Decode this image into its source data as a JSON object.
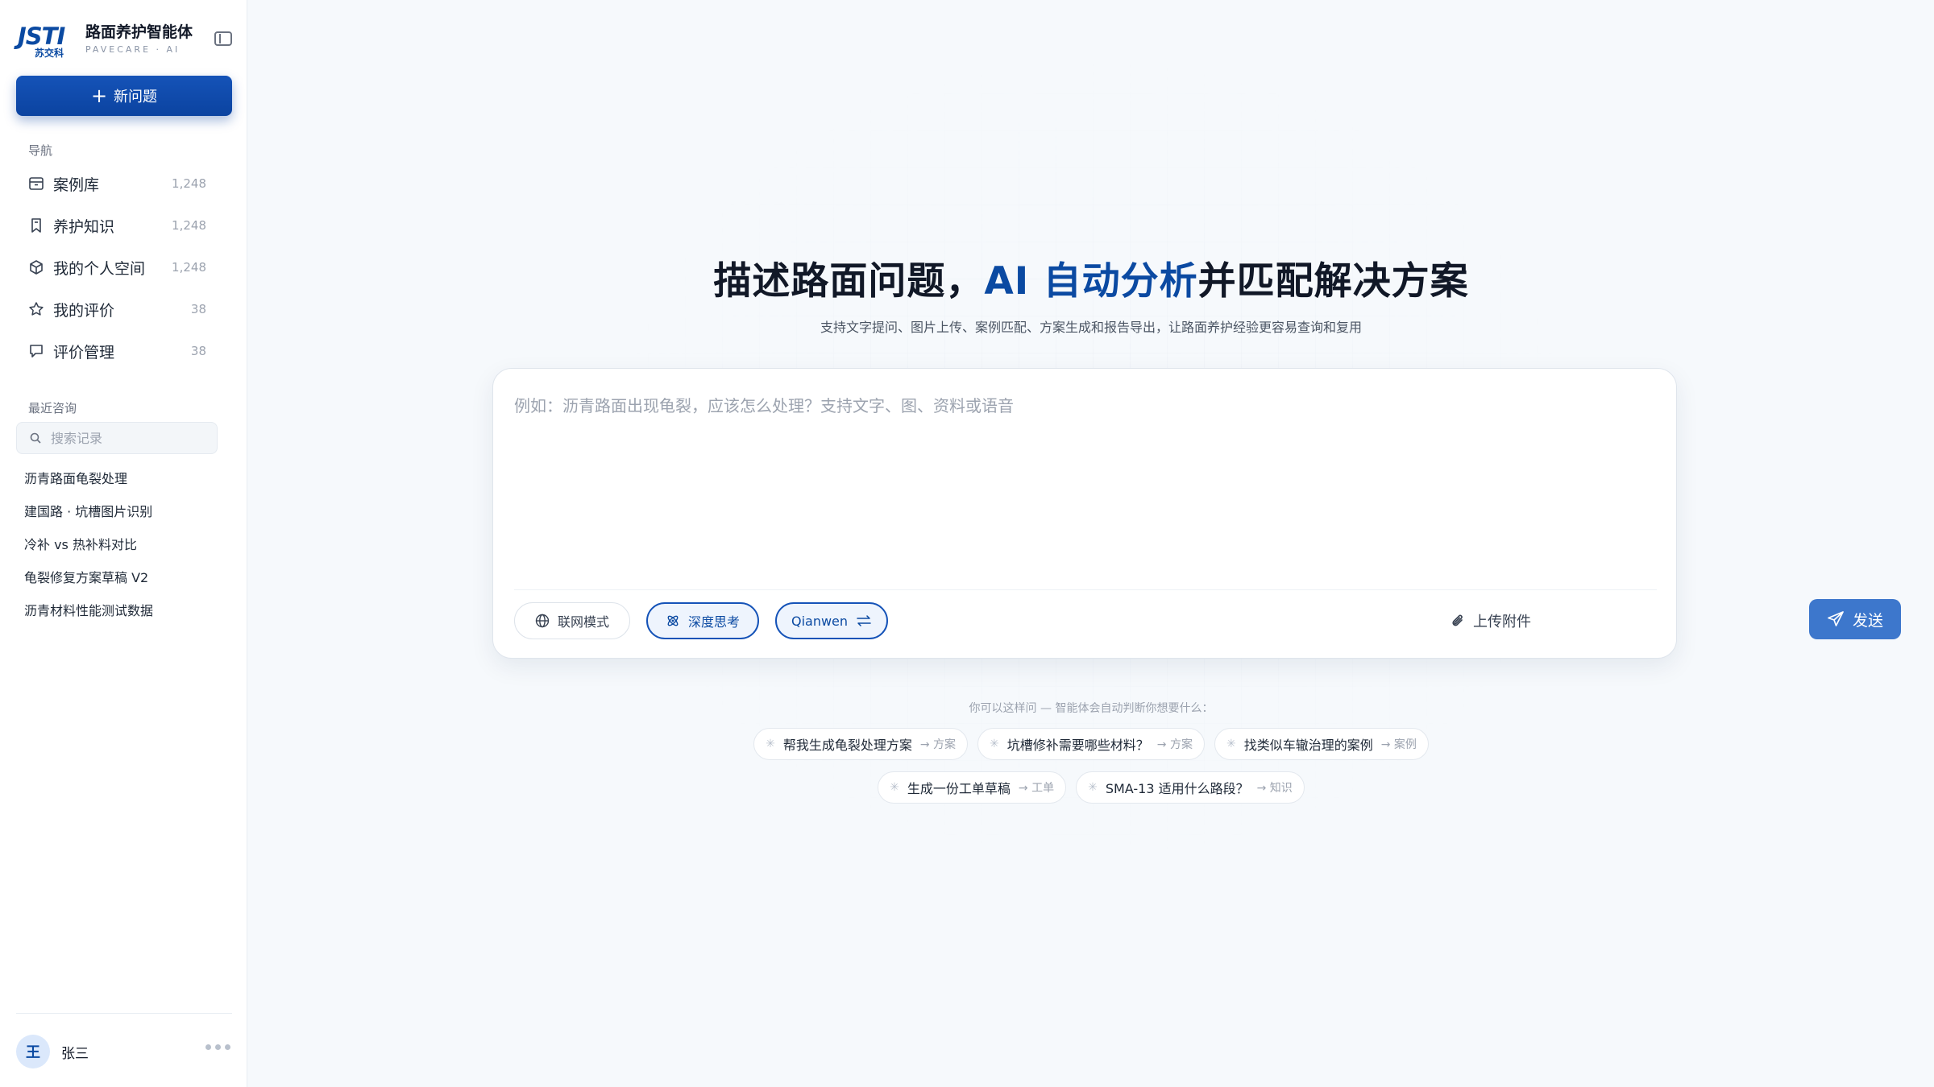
{
  "brand": {
    "logo_text": "JSTI",
    "logo_sub": "苏交科",
    "title": "路面养护智能体",
    "subtitle": "PAVECARE · AI"
  },
  "sidebar": {
    "new_button": "新问题",
    "nav_label": "导航",
    "nav_items": [
      {
        "label": "案例库",
        "count": "1,248",
        "icon": "archive-icon"
      },
      {
        "label": "养护知识",
        "count": "1,248",
        "icon": "bookmark-icon"
      },
      {
        "label": "我的个人空间",
        "count": "1,248",
        "icon": "cube-icon"
      },
      {
        "label": "我的评价",
        "count": "38",
        "icon": "star-icon"
      },
      {
        "label": "评价管理",
        "count": "38",
        "icon": "comment-icon"
      }
    ],
    "recent_label": "最近咨询",
    "search_placeholder": "搜索记录",
    "history": [
      "沥青路面龟裂处理",
      "建国路 · 坑槽图片识别",
      "冷补 vs 热补料对比",
      "龟裂修复方案草稿 V2",
      "沥青材料性能测试数据"
    ],
    "user": {
      "avatar_letter": "王",
      "name": "张三"
    }
  },
  "main": {
    "headline_prefix": "描述路面问题，",
    "headline_accent": "AI 自动分析",
    "headline_suffix": "并匹配解决方案",
    "subline": "支持文字提问、图片上传、案例匹配、方案生成和报告导出，让路面养护经验更容易查询和复用",
    "composer": {
      "placeholder": "例如：沥青路面出现龟裂，应该怎么处理？支持文字、图、资料或语音",
      "web_mode": "联网模式",
      "deep_think": "深度思考",
      "model": "Qianwen",
      "upload": "上传附件",
      "send": "发送"
    },
    "hint": "你可以这样问 — 智能体会自动判断你想要什么：",
    "suggestions_row1": [
      {
        "q": "帮我生成龟裂处理方案",
        "tag": "→ 方案"
      },
      {
        "q": "坑槽修补需要哪些材料？",
        "tag": "→ 方案"
      },
      {
        "q": "找类似车辙治理的案例",
        "tag": "→ 案例"
      }
    ],
    "suggestions_row2": [
      {
        "q": "生成一份工单草稿",
        "tag": "→ 工单"
      },
      {
        "q": "SMA-13 适用什么路段？",
        "tag": "→ 知识"
      }
    ]
  },
  "colors": {
    "brand_blue": "#0b4aa2",
    "send_blue": "#3d77cc",
    "background": "#f6f9fc"
  }
}
